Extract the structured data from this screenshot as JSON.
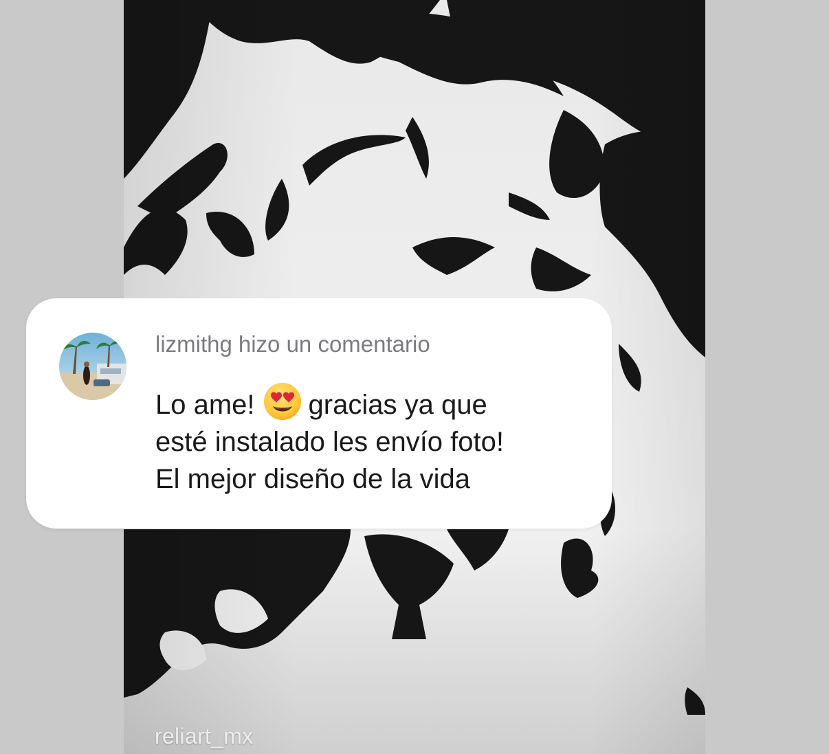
{
  "story": {
    "watermark": "reliart_mx"
  },
  "comment_card": {
    "username": "lizmithg",
    "action_text": "hizo un comentario",
    "comment_part1": "Lo ame!",
    "comment_emoji": "heart-eyes-emoji",
    "comment_part2": "gracias ya que",
    "comment_line2": "esté instalado les envío foto!",
    "comment_line3": "El mejor diseño de la vida"
  },
  "colors": {
    "background": "#c8c9c8",
    "card": "#ffffff",
    "header_text": "#7b7b7f",
    "comment_text": "#1a1a1a",
    "art_black": "#161616",
    "wall": "#ececec"
  }
}
